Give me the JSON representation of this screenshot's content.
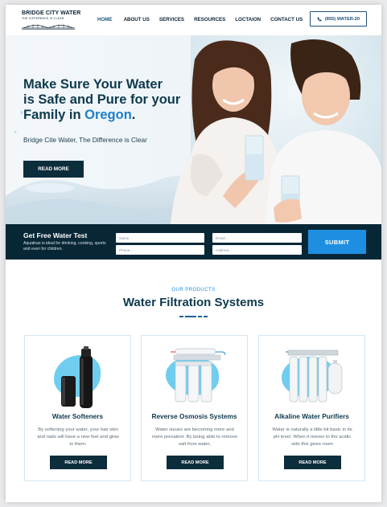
{
  "header": {
    "logo_name": "BRIDGE CITY WATER",
    "logo_tagline": "THE DIFFERENCE IS CLEAR",
    "nav": [
      "HOME",
      "ABOUT US",
      "SERVICES",
      "RESOURCES",
      "LOCTAION",
      "CONTACT US"
    ],
    "phone_label": "(855) WATER-20"
  },
  "hero": {
    "title_line1": "Make Sure Your Water",
    "title_line2": "is Safe and Pure for your",
    "title_line3_prefix": "Family in ",
    "title_highlight": "Oregon",
    "title_suffix": ".",
    "subtitle": "Bridge Cite Water, The Difference is Clear",
    "button": "READ MORE"
  },
  "form": {
    "title": "Get Free Water Test",
    "description": "Aquatiras is ideal for drinking, cooking, sports and even for children.",
    "name_placeholder": "Name...",
    "email_placeholder": "Email...",
    "phone_placeholder": "Phone...",
    "address_placeholder": "Address...",
    "submit": "SUBMIT"
  },
  "products": {
    "eyebrow": "OUR PRODUCTS",
    "title": "Water Filtration Systems",
    "items": [
      {
        "title": "Water Softeners",
        "text": "By softening your water, your hair skin and nails will have a new feel and glow to them.",
        "button": "READ MORE",
        "icon": "water-softener-image"
      },
      {
        "title": "Reverse Osmosis Systems",
        "text": "Water issues are becoming more and more prevalent. By being able to remove salt from water,",
        "button": "READ MORE",
        "icon": "reverse-osmosis-image"
      },
      {
        "title": "Alkaline Water Purifiers",
        "text": "Water is naturally a little bit basic in its pH level. When it moves to the acidic side this gives room",
        "button": "READ MORE",
        "icon": "alkaline-purifier-image"
      }
    ]
  },
  "colors": {
    "navy": "#0c2d3c",
    "accent_blue": "#1e8fe0",
    "highlight": "#1c7fc9"
  }
}
